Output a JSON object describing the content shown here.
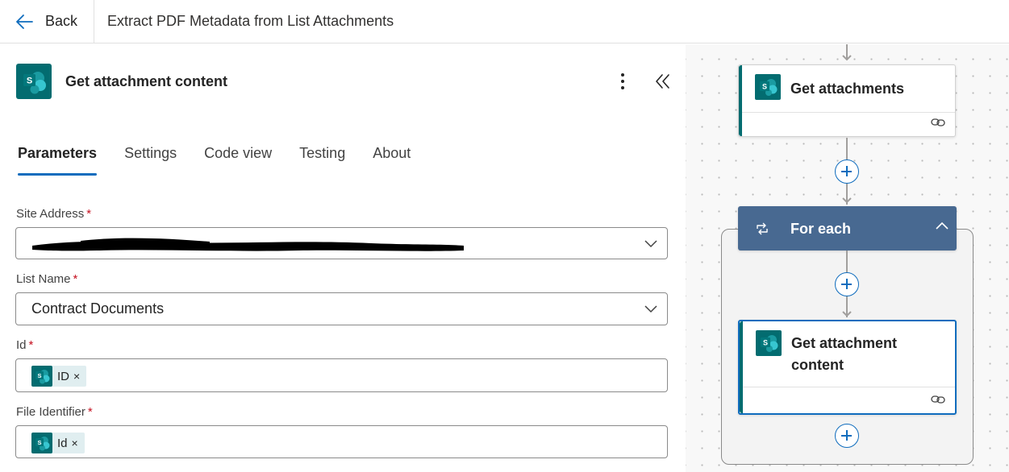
{
  "topbar": {
    "back_label": "Back",
    "flow_title": "Extract PDF Metadata from List Attachments"
  },
  "panel": {
    "title": "Get attachment content",
    "tabs": [
      {
        "label": "Parameters",
        "active": true
      },
      {
        "label": "Settings",
        "active": false
      },
      {
        "label": "Code view",
        "active": false
      },
      {
        "label": "Testing",
        "active": false
      },
      {
        "label": "About",
        "active": false
      }
    ],
    "fields": {
      "site_address": {
        "label": "Site Address",
        "required": "*",
        "value": ""
      },
      "list_name": {
        "label": "List Name",
        "required": "*",
        "value": "Contract Documents"
      },
      "id": {
        "label": "Id",
        "required": "*",
        "token": "ID",
        "remove": "×"
      },
      "file_identifier": {
        "label": "File Identifier",
        "required": "*",
        "token": "Id",
        "remove": "×"
      }
    }
  },
  "canvas": {
    "get_attachments": {
      "title": "Get attachments"
    },
    "for_each": {
      "title": "For each"
    },
    "get_attachment_content": {
      "title_line1": "Get attachment",
      "title_line2": "content"
    }
  },
  "colors": {
    "accent": "#0f6cbd",
    "sharepoint": "#036c70",
    "foreach": "#486991",
    "required": "#c50f1f"
  },
  "icons": [
    "back-arrow-icon",
    "sharepoint-icon",
    "more-vertical-icon",
    "collapse-double-chevron-icon",
    "chevron-down-icon",
    "link-icon",
    "loop-icon",
    "chevron-up-icon",
    "plus-icon"
  ]
}
